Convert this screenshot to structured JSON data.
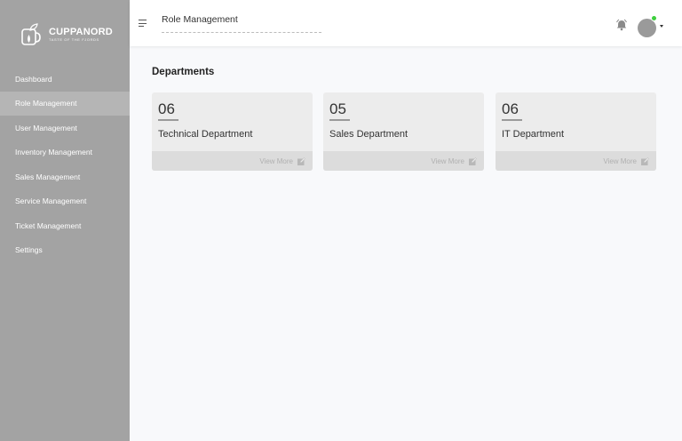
{
  "brand": {
    "name": "CUPPANORD",
    "tagline": "TASTE OF THE FJORDS"
  },
  "sidebar": {
    "items": [
      {
        "label": "Dashboard"
      },
      {
        "label": "Role Management",
        "active": true
      },
      {
        "label": "User Management"
      },
      {
        "label": "Inventory Management"
      },
      {
        "label": "Sales Management"
      },
      {
        "label": "Service Management"
      },
      {
        "label": "Ticket Management"
      },
      {
        "label": "Settings"
      }
    ]
  },
  "header": {
    "title": "Role Management",
    "icons": [
      "menu-icon",
      "bell-icon",
      "avatar",
      "chevron-down-icon"
    ]
  },
  "main": {
    "section_title": "Departments",
    "cards": [
      {
        "count": "06",
        "name": "Technical Department",
        "action": "View More"
      },
      {
        "count": "05",
        "name": "Sales Department",
        "action": "View More"
      },
      {
        "count": "06",
        "name": "IT Department",
        "action": "View More"
      }
    ]
  },
  "colors": {
    "sidebar": "#a3a3a3",
    "sidebar_active": "#b5b5b5",
    "status_online": "#3ecf3e"
  }
}
